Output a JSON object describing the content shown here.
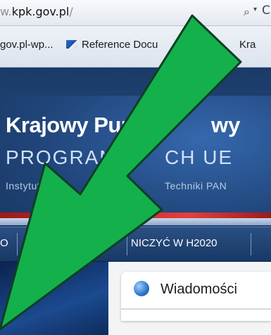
{
  "browser": {
    "url_prefix": "w.",
    "url_domain": "kpk.gov.pl",
    "url_path": "/",
    "search_glyph": "⌕",
    "dropdown_glyph": "▾",
    "refresh_glyph": "C"
  },
  "favorites": [
    {
      "label": "gov.pl-wp..."
    },
    {
      "label": "Reference Docu"
    },
    {
      "label": "Kra"
    }
  ],
  "site": {
    "title_left": "Krajowy Pun",
    "title_right": "wy",
    "subtitle_left": "PROGRAMÓ",
    "subtitle_right": "CH UE",
    "institute_left": "Instytut Podst",
    "institute_right": "Techniki PAN"
  },
  "nav": {
    "left_item": "O",
    "middle_item": "NICZYĆ W H2020"
  },
  "news": {
    "title": "Wiadomości"
  },
  "colors": {
    "arrow_fill": "#14b04c",
    "arrow_stroke": "#0d3f24",
    "header_bg": "#21467c",
    "accent_red": "#d02828"
  }
}
